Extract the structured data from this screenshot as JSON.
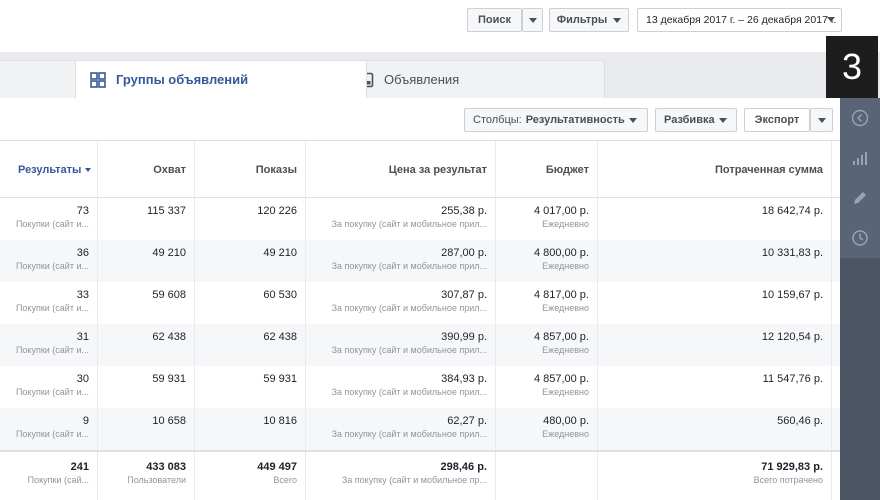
{
  "toolbar": {
    "search_label": "Поиск",
    "filters_label": "Фильтры",
    "date_range": "13 декабря 2017 г. – 26 декабря 2017 г."
  },
  "tabs": [
    {
      "label": "Группы объявлений",
      "icon": "grid-icon",
      "active": true
    },
    {
      "label": "Объявления",
      "icon": "ad-preview-icon",
      "active": false
    }
  ],
  "badge": "3",
  "actions": {
    "columns_prefix": "Столбцы:",
    "columns_value": "Результативность",
    "breakdown_label": "Разбивка",
    "export_label": "Экспорт"
  },
  "table": {
    "columns": [
      "Результаты",
      "Охват",
      "Показы",
      "Цена за результат",
      "Бюджет",
      "Потраченная сумма"
    ],
    "rows": [
      {
        "results": "73",
        "results_sub": "Покупки (сайт и...",
        "reach": "115 337",
        "impressions": "120 226",
        "cpr": "255,38 р.",
        "cpr_sub": "За покупку (сайт и мобильное прил...",
        "budget": "4 017,00 р.",
        "budget_sub": "Ежедневно",
        "spent": "18 642,74 р."
      },
      {
        "results": "36",
        "results_sub": "Покупки (сайт и...",
        "reach": "49 210",
        "impressions": "49 210",
        "cpr": "287,00 р.",
        "cpr_sub": "За покупку (сайт и мобильное прил...",
        "budget": "4 800,00 р.",
        "budget_sub": "Ежедневно",
        "spent": "10 331,83 р."
      },
      {
        "results": "33",
        "results_sub": "Покупки (сайт и...",
        "reach": "59 608",
        "impressions": "60 530",
        "cpr": "307,87 р.",
        "cpr_sub": "За покупку (сайт и мобильное прил...",
        "budget": "4 817,00 р.",
        "budget_sub": "Ежедневно",
        "spent": "10 159,67 р."
      },
      {
        "results": "31",
        "results_sub": "Покупки (сайт и...",
        "reach": "62 438",
        "impressions": "62 438",
        "cpr": "390,99 р.",
        "cpr_sub": "За покупку (сайт и мобильное прил...",
        "budget": "4 857,00 р.",
        "budget_sub": "Ежедневно",
        "spent": "12 120,54 р."
      },
      {
        "results": "30",
        "results_sub": "Покупки (сайт и...",
        "reach": "59 931",
        "impressions": "59 931",
        "cpr": "384,93 р.",
        "cpr_sub": "За покупку (сайт и мобильное прил...",
        "budget": "4 857,00 р.",
        "budget_sub": "Ежедневно",
        "spent": "11 547,76 р."
      },
      {
        "results": "9",
        "results_sub": "Покупки (сайт и...",
        "reach": "10 658",
        "impressions": "10 816",
        "cpr": "62,27 р.",
        "cpr_sub": "За покупку (сайт и мобильное прил...",
        "budget": "480,00 р.",
        "budget_sub": "Ежедневно",
        "spent": "560,46 р."
      }
    ],
    "totals": {
      "results": "241",
      "results_sub": "Покупки (сай...",
      "reach": "433 083",
      "reach_sub": "Пользователи",
      "impressions": "449 497",
      "impressions_sub": "Всего",
      "cpr": "298,46 р.",
      "cpr_sub": "За покупку (сайт и мобильное пр...",
      "spent": "71 929,83 р.",
      "spent_sub": "Всего потрачено"
    }
  },
  "colors": {
    "accent": "#365899",
    "rail": "#4b5563",
    "badge": "#1d1d1d"
  }
}
